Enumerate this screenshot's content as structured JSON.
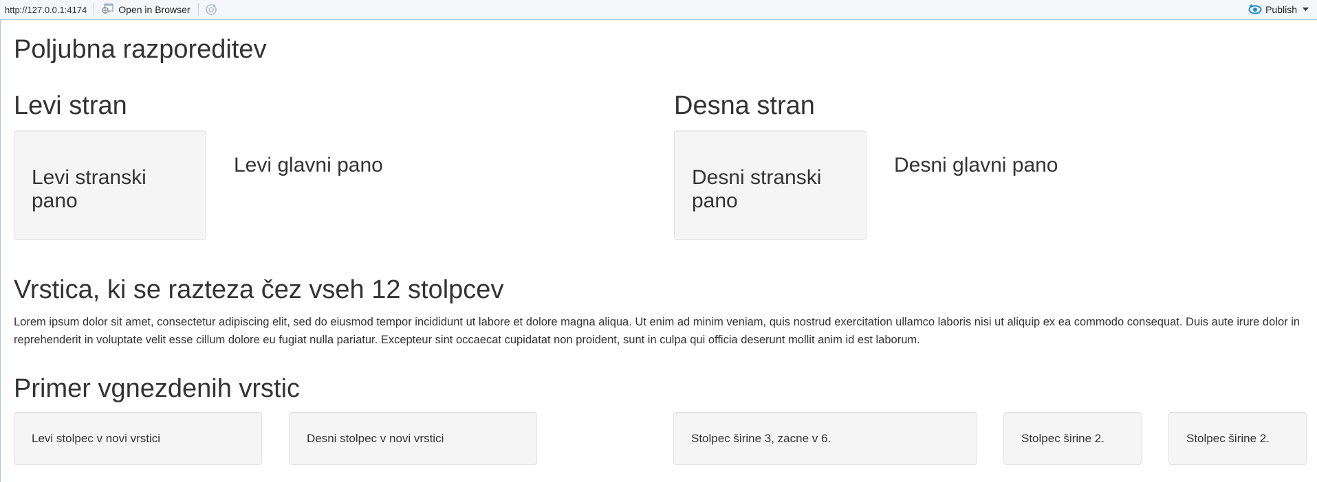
{
  "toolbar": {
    "url": "http://127.0.0.1:4174",
    "open_in_browser": "Open in Browser",
    "publish": "Publish"
  },
  "page": {
    "title": "Poljubna razporeditev"
  },
  "left": {
    "title": "Levi stran",
    "sidebar": "Levi stranski pano",
    "main": "Levi glavni pano"
  },
  "right": {
    "title": "Desna stran",
    "sidebar": "Desni stranski pano",
    "main": "Desni glavni pano"
  },
  "full_row": {
    "title": "Vrstica, ki se razteza čez vseh 12 stolpcev",
    "text": "Lorem ipsum dolor sit amet, consectetur adipiscing elit, sed do eiusmod tempor incididunt ut labore et dolore magna aliqua. Ut enim ad minim veniam, quis nostrud exercitation ullamco laboris nisi ut aliquip ex ea commodo consequat. Duis aute irure dolor in reprehenderit in voluptate velit esse cillum dolore eu fugiat nulla pariatur. Excepteur sint occaecat cupidatat non proident, sunt in culpa qui officia deserunt mollit anim id est laborum."
  },
  "nested": {
    "title": "Primer vgnezdenih vrstic",
    "items": [
      "Levi stolpec v novi vrstici",
      "Desni stolpec v novi vrstici",
      "Stolpec širine 3, zacne v 6.",
      "Stolpec širine 2.",
      "Stolpec širine 2."
    ]
  }
}
